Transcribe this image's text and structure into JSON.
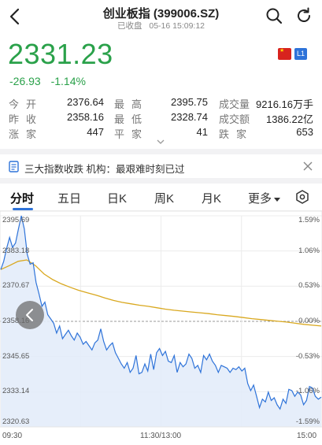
{
  "header": {
    "title": "创业板指 (399006.SZ)",
    "status": "已收盘",
    "datetime": "05-16 15:09:12"
  },
  "quote": {
    "price": "2331.23",
    "change": "-26.93",
    "change_pct": "-1.14%",
    "level_badge": "L1",
    "color_down": "#2aa14a"
  },
  "stats": [
    [
      {
        "label": "今开",
        "value": "2376.64"
      },
      {
        "label": "最高",
        "value": "2395.75"
      },
      {
        "label": "成交量",
        "value": "9216.16万手"
      }
    ],
    [
      {
        "label": "昨收",
        "value": "2358.16"
      },
      {
        "label": "最低",
        "value": "2328.74"
      },
      {
        "label": "成交额",
        "value": "1386.22亿"
      }
    ],
    [
      {
        "label": "涨家",
        "value": "447"
      },
      {
        "label": "平家",
        "value": "41"
      },
      {
        "label": "跌家",
        "value": "653"
      }
    ]
  ],
  "news": {
    "text": "三大指数收跌  机构：最艰难时刻已过"
  },
  "tabs": [
    "分时",
    "五日",
    "日K",
    "周K",
    "月K",
    "更多"
  ],
  "active_tab": "分时",
  "chart_data": {
    "type": "line",
    "y_left_ticks": [
      "2395.69",
      "2383.18",
      "2370.67",
      "2358.16",
      "2345.65",
      "2333.14",
      "2320.63"
    ],
    "y_right_ticks": [
      "1.59%",
      "1.06%",
      "0.53%",
      "0.00%",
      "-0.53%",
      "-1.06%",
      "-1.59%"
    ],
    "x_ticks": [
      "09:30",
      "11:30/13:00",
      "15:00"
    ],
    "ylim": [
      2320.63,
      2395.69
    ],
    "reference": 2358.16,
    "series": [
      {
        "values": [
          2376.6,
          2379.5,
          2384.2,
          2388.0,
          2384.5,
          2386.0,
          2391.0,
          2395.7,
          2391.0,
          2382.0,
          2378.5,
          2379.0,
          2372.0,
          2368.0,
          2363.5,
          2365.0,
          2360.5,
          2359.0,
          2357.5,
          2354.0,
          2356.5,
          2352.0,
          2353.5,
          2355.0,
          2353.0,
          2351.5,
          2354.0,
          2352.5,
          2350.0,
          2351.0,
          2349.5,
          2348.0,
          2350.5,
          2351.5,
          2355.5,
          2351.0,
          2348.0,
          2349.5,
          2350.5,
          2347.0,
          2345.0,
          2343.0,
          2341.5,
          2343.5,
          2340.0,
          2341.5,
          2346.0,
          2339.5,
          2340.0,
          2343.0,
          2340.5,
          2346.5,
          2341.0,
          2347.0,
          2348.5,
          2346.0,
          2347.5,
          2344.0,
          2343.5,
          2346.0,
          2340.0,
          2343.5,
          2342.0,
          2343.0,
          2346.5,
          2345.0,
          2341.5,
          2342.5,
          2340.0,
          2346.0,
          2344.5,
          2346.5,
          2344.0,
          2342.5,
          2340.0,
          2342.5,
          2342.0,
          2341.5,
          2340.0,
          2341.5,
          2341.0,
          2342.0,
          2340.5,
          2341.5,
          2336.0,
          2333.5,
          2335.5,
          2331.5,
          2327.5,
          2330.5,
          2329.5,
          2333.0,
          2330.0,
          2331.0,
          2328.5,
          2327.0,
          2330.5,
          2329.0,
          2334.0,
          2333.5,
          2331.5,
          2333.0,
          2332.0,
          2328.5,
          2330.0,
          2335.0,
          2334.5,
          2331.5,
          2330.5,
          2331.2
        ]
      },
      {
        "values": [
          2376.6,
          2378.0,
          2379.5,
          2380.0,
          2378.0,
          2375.0,
          2373.0,
          2371.5,
          2370.3,
          2369.2,
          2368.3,
          2367.5,
          2366.5,
          2365.6,
          2364.9,
          2364.4,
          2363.9,
          2363.5,
          2363.0,
          2362.5,
          2362.1,
          2361.8,
          2361.5,
          2361.2,
          2360.9,
          2360.5,
          2360.2,
          2359.9,
          2359.5,
          2359.1,
          2358.8,
          2358.5,
          2358.2,
          2357.9,
          2357.5,
          2357.1,
          2356.8,
          2356.5
        ]
      }
    ]
  }
}
